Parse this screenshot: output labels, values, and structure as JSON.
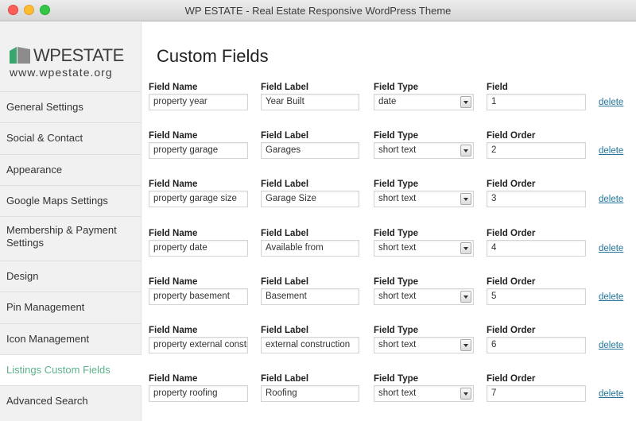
{
  "window": {
    "title": "WP ESTATE - Real Estate Responsive WordPress Theme"
  },
  "logo": {
    "text": "WPESTATE",
    "url": "www.wpestate.org"
  },
  "sidebar": {
    "items": [
      {
        "label": "General Settings"
      },
      {
        "label": "Social & Contact"
      },
      {
        "label": "Appearance"
      },
      {
        "label": "Google Maps Settings"
      },
      {
        "label": "Membership & Payment Settings"
      },
      {
        "label": "Design"
      },
      {
        "label": "Pin Management"
      },
      {
        "label": "Icon Management"
      },
      {
        "label": "Listings Custom Fields"
      },
      {
        "label": "Advanced Search"
      }
    ],
    "active_index": 8,
    "active_color": "#5bb38a"
  },
  "main": {
    "title": "Custom Fields",
    "delete_label": "delete",
    "rows": [
      {
        "name_label": "Field Name",
        "label_label": "Field Label",
        "type_label": "Field Type",
        "order_label": "Field",
        "name": "property year",
        "label": "Year Built",
        "type": "date",
        "order": "1"
      },
      {
        "name_label": "Field Name",
        "label_label": "Field Label",
        "type_label": "Field Type",
        "order_label": "Field Order",
        "name": "property garage",
        "label": "Garages",
        "type": "short text",
        "order": "2"
      },
      {
        "name_label": "Field Name",
        "label_label": "Field Label",
        "type_label": "Field Type",
        "order_label": "Field Order",
        "name": "property garage size",
        "label": "Garage Size",
        "type": "short text",
        "order": "3"
      },
      {
        "name_label": "Field Name",
        "label_label": "Field Label",
        "type_label": "Field Type",
        "order_label": "Field Order",
        "name": "property date",
        "label": "Available from",
        "type": "short text",
        "order": "4"
      },
      {
        "name_label": "Field Name",
        "label_label": "Field Label",
        "type_label": "Field Type",
        "order_label": "Field Order",
        "name": "property basement",
        "label": "Basement",
        "type": "short text",
        "order": "5"
      },
      {
        "name_label": "Field Name",
        "label_label": "Field Label",
        "type_label": "Field Type",
        "order_label": "Field Order",
        "name": "property external constr",
        "label": "external construction",
        "type": "short text",
        "order": "6"
      },
      {
        "name_label": "Field Name",
        "label_label": "Field Label",
        "type_label": "Field Type",
        "order_label": "Field Order",
        "name": "property roofing",
        "label": "Roofing",
        "type": "short text",
        "order": "7"
      }
    ]
  }
}
